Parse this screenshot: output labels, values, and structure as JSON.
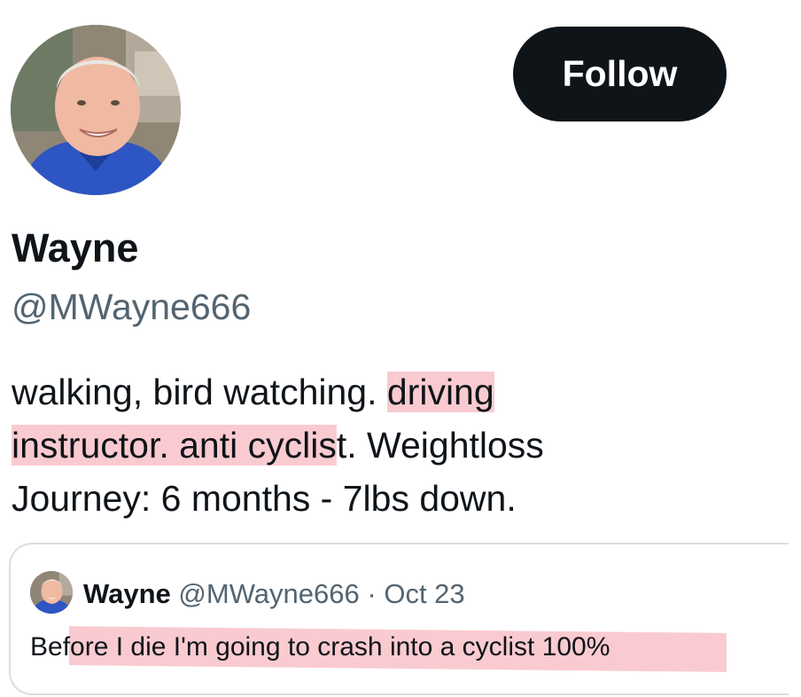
{
  "profile": {
    "display_name": "Wayne",
    "handle": "@MWayne666",
    "follow_label": "Follow",
    "bio": {
      "part1": "walking, bird watching. ",
      "highlight1": "driving",
      "part2": " ",
      "highlight2": "instructor. anti cyclis",
      "part3": "t. Weightloss Journey: 6 months - 7lbs down."
    }
  },
  "quoted_tweet": {
    "name": "Wayne",
    "handle": "@MWayne666",
    "separator": "·",
    "date": "Oct 23",
    "text": "Before I die I'm going to crash into a cyclist 100%"
  },
  "colors": {
    "follow_bg": "#0f1419",
    "secondary_text": "#536471",
    "highlight": "#f4a0aa",
    "border": "#d9dee3"
  }
}
